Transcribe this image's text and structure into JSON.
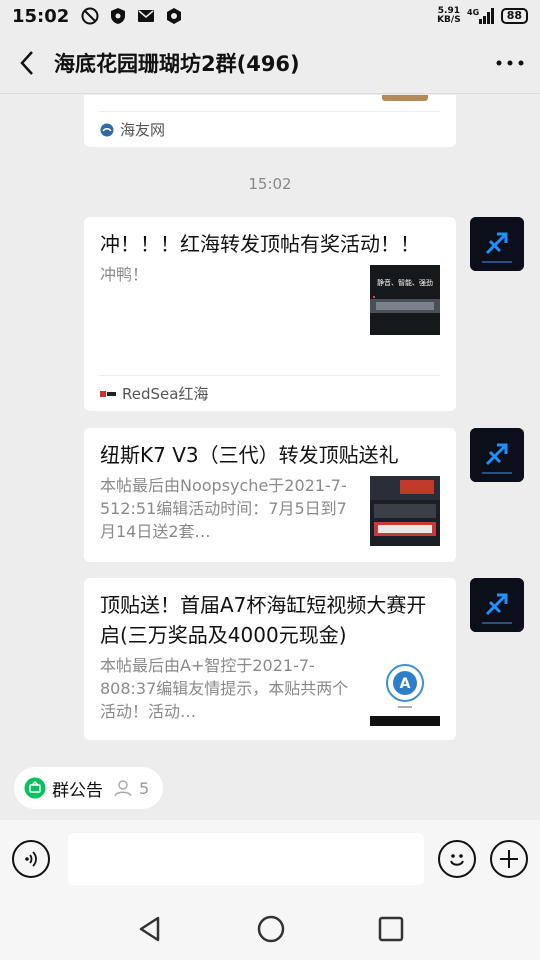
{
  "status": {
    "time": "15:02",
    "net_speed_value": "5.91",
    "net_speed_unit": "KB/S",
    "network": "4G",
    "battery": "88"
  },
  "header": {
    "title": "海底花园珊瑚坊2群(496)"
  },
  "messages": [
    {
      "type": "link_card_partial",
      "source": "海友网"
    },
    {
      "type": "timestamp",
      "text": "15:02"
    },
    {
      "type": "link_card",
      "title": "冲！！！红海转发顶帖有奖活动！！",
      "desc": "冲鸭！",
      "source": "RedSea红海",
      "thumb_icon": "redsea-product-thumbnail",
      "thumb_text_1": "静音、智能、强劲"
    },
    {
      "type": "link_card",
      "title": "纽斯K7 V3（三代）转发顶贴送礼",
      "desc": "本帖最后由Noopsyche于2021-7-512:51编辑活动时间：7月5日到7月14日送2套…",
      "thumb_icon": "aquarium-light-thumbnail"
    },
    {
      "type": "link_card",
      "title": "顶贴送！首届A7杯海缸短视频大赛开启(三万奖品及4000元现金)",
      "desc": "本帖最后由A+智控于2021-7-808:37编辑友情提示，本贴共两个活动！活动…",
      "thumb_icon": "a-plus-logo-thumbnail"
    }
  ],
  "announcement": {
    "label": "群公告",
    "count": "5"
  },
  "input": {
    "placeholder": ""
  },
  "colors": {
    "background": "#ededed",
    "card": "#ffffff",
    "accent_green": "#07c160",
    "avatar_bg": "#0b0f19",
    "avatar_accent": "#1e90ff"
  }
}
